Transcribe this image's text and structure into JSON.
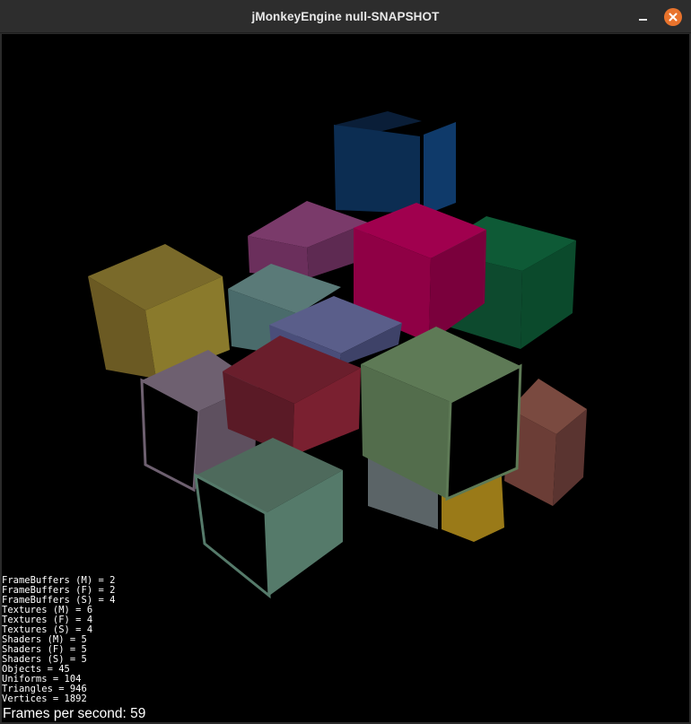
{
  "window": {
    "title": "jMonkeyEngine null-SNAPSHOT",
    "minimize_icon": "minimize-icon",
    "close_icon": "close-icon",
    "close_color": "#e8732c"
  },
  "scene": {
    "background": "#000000",
    "cube_colors": [
      "#0c2d52",
      "#0d4a2e",
      "#6b2f5c",
      "#8f0045",
      "#6b5a23",
      "#4a6b6b",
      "#4a4e7a",
      "#5e505f",
      "#6a1e2c",
      "#536d4c",
      "#6b3d36",
      "#9a7a18",
      "#5b6467",
      "#557a6a"
    ]
  },
  "stats": [
    "FrameBuffers (M) = 2",
    "FrameBuffers (F) = 2",
    "FrameBuffers (S) = 4",
    "Textures (M) = 6",
    "Textures (F) = 4",
    "Textures (S) = 4",
    "Shaders (M) = 5",
    "Shaders (F) = 5",
    "Shaders (S) = 5",
    "Objects = 45",
    "Uniforms = 104",
    "Triangles = 946",
    "Vertices = 1892"
  ],
  "fps": {
    "label": "Frames per second: 59"
  }
}
